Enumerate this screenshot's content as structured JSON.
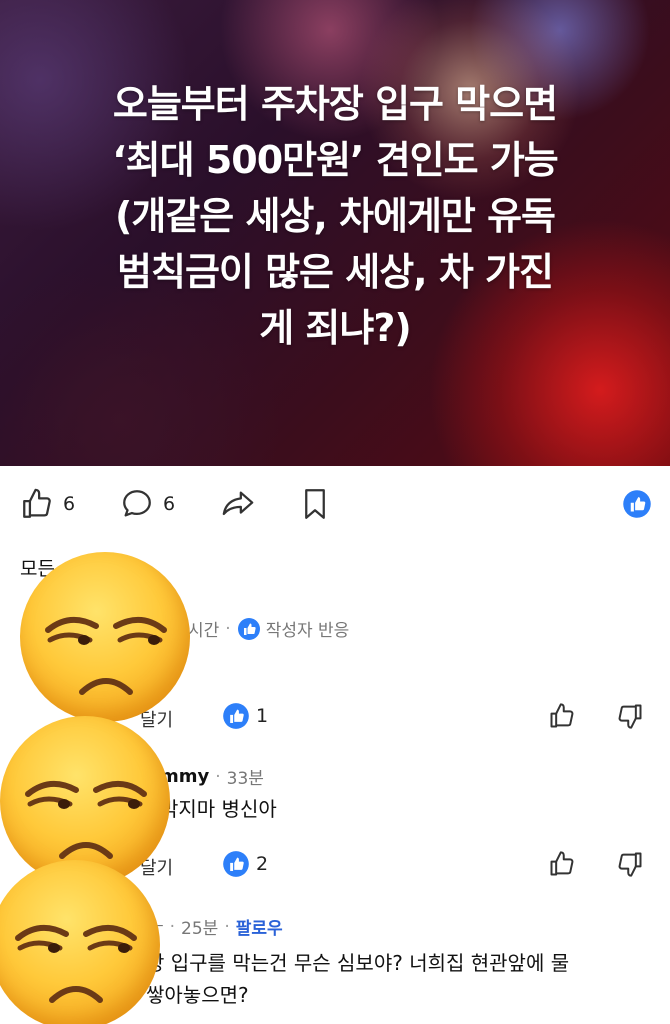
{
  "post": {
    "title_lines": "오늘부터 주차장 입구 막으면\n‘최대 500만원’ 견인도 가능\n(개같은 세상, 차에게만 유독\n범칙금이 많은 세상, 차 가진\n게 죄냐?)"
  },
  "actions": {
    "like_count": "6",
    "comment_count": "6"
  },
  "comments": {
    "sort_label": "모든",
    "items": [
      {
        "time": "시간",
        "badge": "작성자 반응",
        "reply_label": "달기",
        "reaction_count": "1"
      },
      {
        "author": "mmy",
        "time": "33분",
        "text": "막지마 병신아",
        "reply_label": "달기",
        "reaction_count": "2"
      },
      {
        "author": "ㅜ",
        "time": "25분",
        "follow": "팔로우",
        "text_line1": "장 입구를 막는건 무슨 심보야? 너희집 현관앞에 물",
        "text_line2": "쌓아놓으면?"
      }
    ]
  },
  "colors": {
    "facebook_blue": "#2d7ff9",
    "follow_blue": "#2a62d8",
    "emoji_yellow": "#ffc93a"
  },
  "icons": [
    "like-icon",
    "comment-icon",
    "share-icon",
    "bookmark-icon",
    "facebook-like-badge-icon",
    "unamused-face-emoji",
    "thumbs-up-icon",
    "thumbs-down-icon"
  ]
}
